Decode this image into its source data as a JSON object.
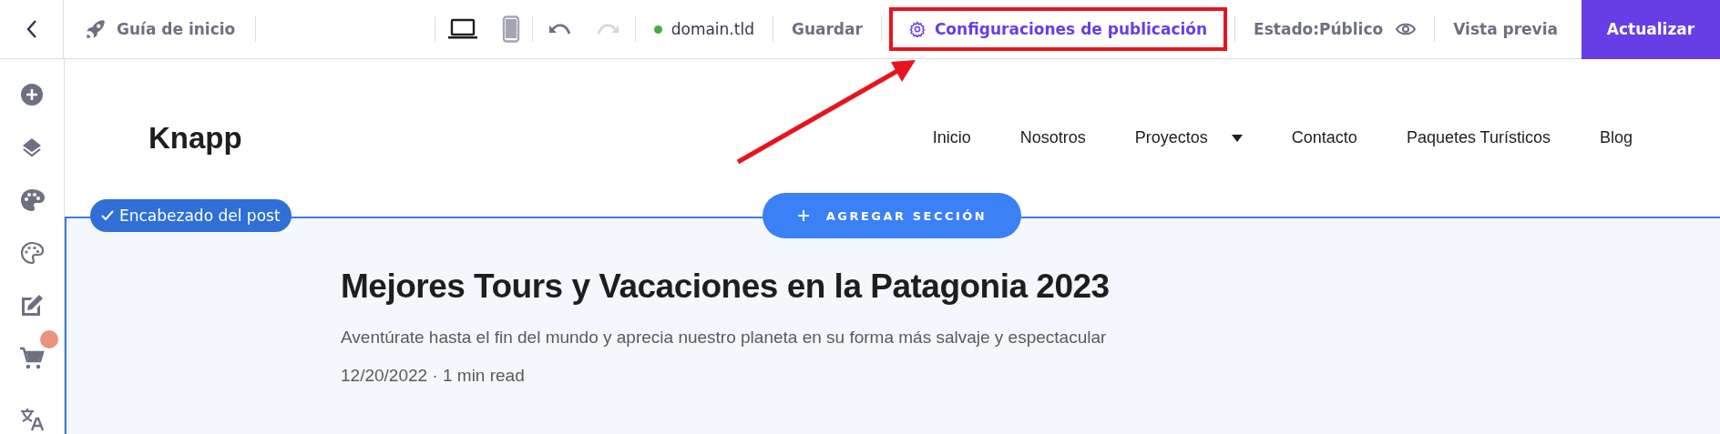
{
  "toolbar": {
    "guide": "Guía de inicio",
    "devices": [
      {
        "kind": "desktop",
        "selected": true
      },
      {
        "kind": "mobile",
        "selected": false
      }
    ],
    "history": [
      {
        "kind": "undo",
        "disabled": false
      },
      {
        "kind": "redo",
        "disabled": true
      }
    ],
    "domain": {
      "text": "domain.tld",
      "color": "#3fae4a"
    },
    "actions": [
      {
        "label": "Guardar",
        "highlighted": false
      },
      {
        "label": "Configuraciones de publicación",
        "highlighted": true
      }
    ],
    "status": "Estado:Público",
    "preview": "Vista previa",
    "primary": "Actualizar"
  },
  "sidebar": {
    "items": [
      {
        "kind": "add",
        "notification": false
      },
      {
        "kind": "layers",
        "notification": false
      },
      {
        "kind": "styles",
        "notification": false
      },
      {
        "kind": "colors",
        "notification": false
      },
      {
        "kind": "edit",
        "notification": false
      },
      {
        "kind": "store",
        "notification": true
      },
      {
        "kind": "translate",
        "notification": false
      }
    ]
  },
  "site": {
    "logo": "Knapp",
    "nav": [
      {
        "label": "Inicio",
        "dropdown": false
      },
      {
        "label": "Nosotros",
        "dropdown": false
      },
      {
        "label": "Proyectos",
        "dropdown": true
      },
      {
        "label": "Contacto",
        "dropdown": false
      },
      {
        "label": "Paquetes Turísticos",
        "dropdown": false
      },
      {
        "label": "Blog",
        "dropdown": false
      }
    ]
  },
  "section": {
    "tag": "Encabezado del post",
    "add_button": "AGREGAR SECCIÓN",
    "title": "Mejores Tours y Vacaciones en la Patagonia 2023",
    "subtitle": "Aventúrate hasta el fin del mundo y aprecia nuestro planeta en su forma más salvaje y espectacular",
    "meta": "12/20/2022 · 1 min read"
  }
}
